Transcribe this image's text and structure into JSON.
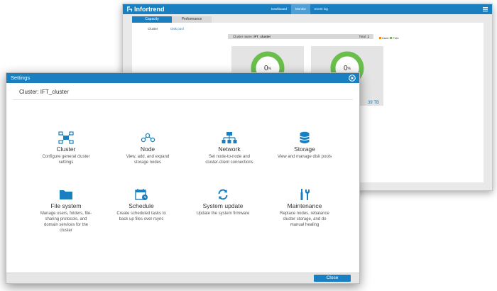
{
  "app": {
    "brand": "Infortrend",
    "nav": [
      "Dashboard",
      "Monitor",
      "Event log"
    ],
    "active_nav": 1,
    "tabs": [
      "Capacity",
      "Performance"
    ],
    "subtabs": [
      "Cluster",
      "Disk pool"
    ],
    "cluster_bar": {
      "name_label": "Cluster name:",
      "name": "IFT_cluster",
      "total_label": "Total:",
      "total": "1"
    },
    "legend": [
      {
        "label": "Used",
        "color": "#f28c28"
      },
      {
        "label": "Free",
        "color": "#6abf4b"
      }
    ],
    "cards": [
      {
        "value": "0",
        "unit": "%",
        "progress": 0
      },
      {
        "value": "0",
        "unit": "%",
        "progress": 0
      }
    ],
    "tb_peek": "39 TB",
    "colors": {
      "accent": "#1a7fc1",
      "free": "#6abf4b"
    }
  },
  "dialog": {
    "title": "Settings",
    "heading": "Cluster: IFT_cluster",
    "items": [
      {
        "icon": "cluster-icon",
        "title": "Cluster",
        "desc": [
          "Configure general cluster",
          "settings"
        ]
      },
      {
        "icon": "node-icon",
        "title": "Node",
        "desc": [
          "View, add, and expand",
          "storage nodes"
        ]
      },
      {
        "icon": "network-icon",
        "title": "Network",
        "desc": [
          "Set node-to-node and",
          "cluster-client connections"
        ]
      },
      {
        "icon": "storage-icon",
        "title": "Storage",
        "desc": [
          "View and manage disk pools"
        ]
      },
      {
        "icon": "folder-icon",
        "title": "File system",
        "desc": [
          "Manage users, folders, file-",
          "sharing protocols, and",
          "domain services for the",
          "cluster"
        ]
      },
      {
        "icon": "calendar-clock-icon",
        "title": "Schedule",
        "desc": [
          "Create scheduled tasks to",
          "back up files over rsync"
        ]
      },
      {
        "icon": "refresh-icon",
        "title": "System update",
        "desc": [
          "Update the system firmware"
        ]
      },
      {
        "icon": "tools-icon",
        "title": "Maintenance",
        "desc": [
          "Replace nodes, rebalance",
          "cluster storage, and do",
          "manual healing"
        ]
      }
    ],
    "close_label": "Close"
  }
}
